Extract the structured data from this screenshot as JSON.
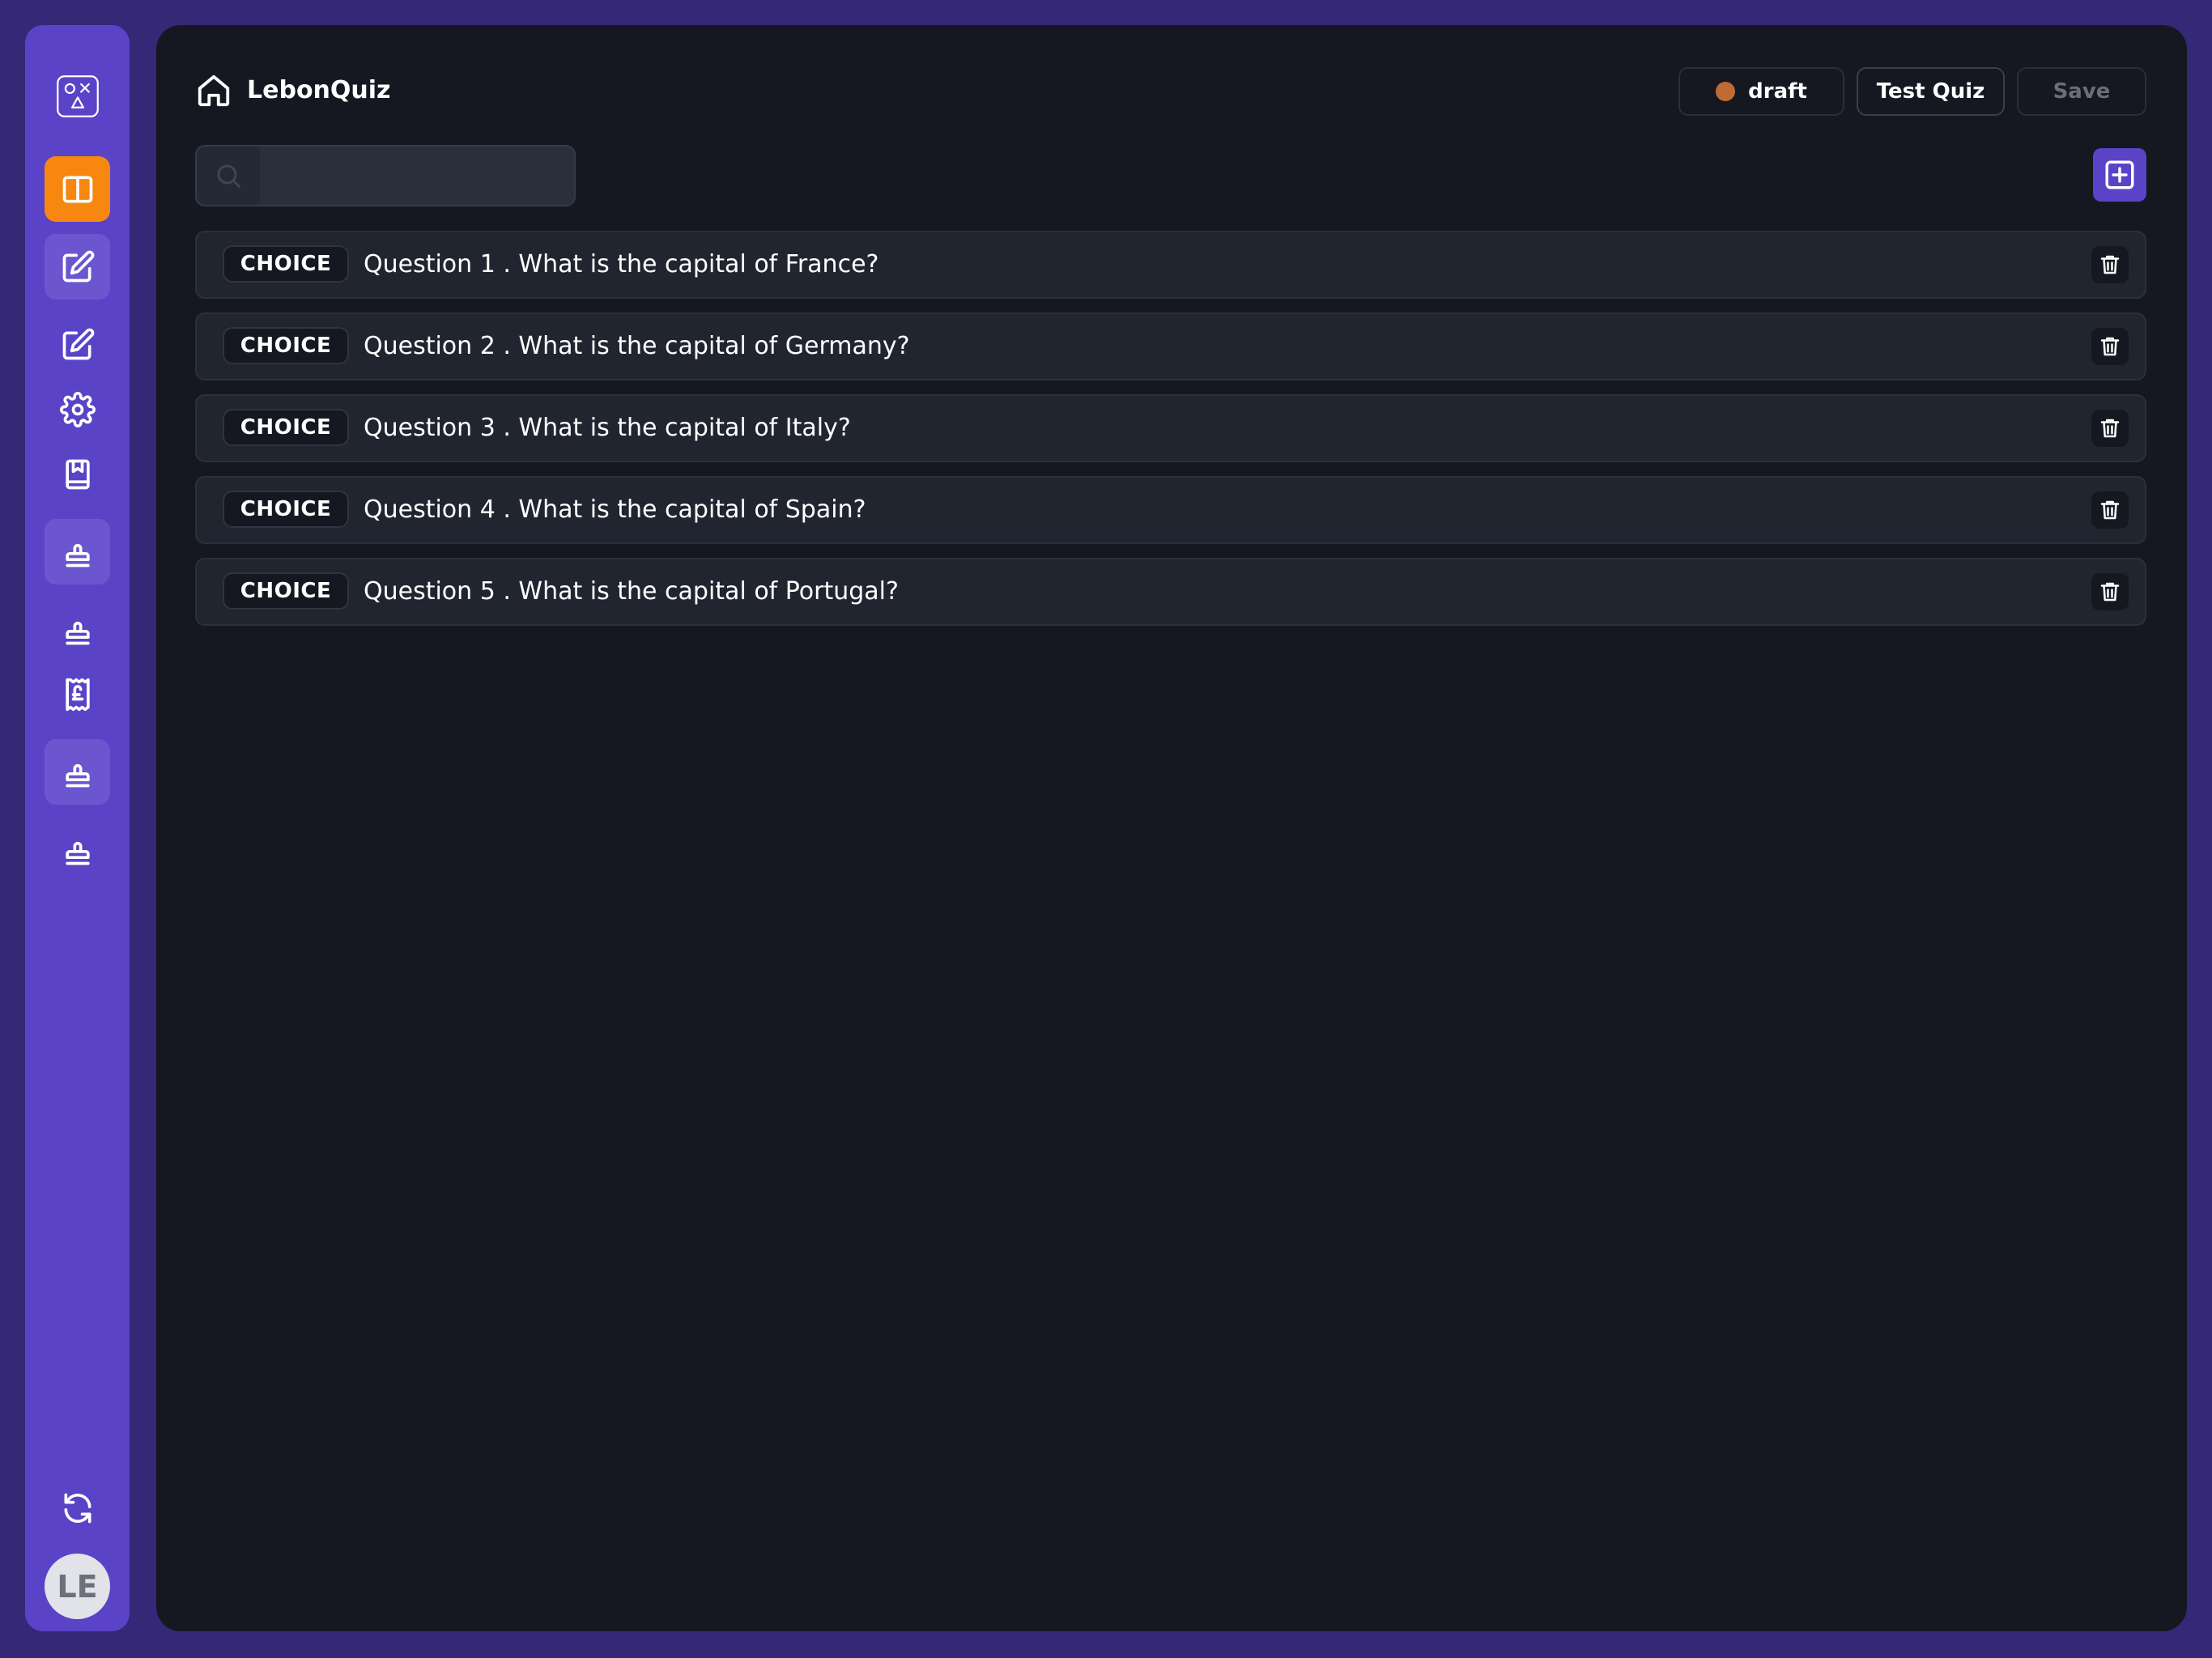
{
  "app": {
    "title": "LebonQuiz"
  },
  "header": {
    "status_label": "draft",
    "status_color": "#c06b32",
    "test_label": "Test Quiz",
    "save_label": "Save"
  },
  "search": {
    "value": "",
    "placeholder": ""
  },
  "sidebar": {
    "items": [
      {
        "icon": "logo-icon",
        "state": "default"
      },
      {
        "icon": "layout-panel-icon",
        "state": "active"
      },
      {
        "icon": "edit-icon",
        "state": "tinted"
      },
      {
        "icon": "edit-icon",
        "state": "default"
      },
      {
        "icon": "gear-icon",
        "state": "default"
      },
      {
        "icon": "bookmark-book-icon",
        "state": "default"
      },
      {
        "icon": "stamp-icon",
        "state": "tinted"
      },
      {
        "icon": "stamp-icon",
        "state": "default"
      },
      {
        "icon": "pound-receipt-icon",
        "state": "default"
      },
      {
        "icon": "stamp-icon",
        "state": "tinted"
      },
      {
        "icon": "stamp-icon",
        "state": "default"
      },
      {
        "icon": "refresh-icon",
        "state": "default"
      }
    ],
    "avatar_initials": "LE"
  },
  "questions": [
    {
      "type": "CHOICE",
      "text": "Question 1 . What is the capital of France?"
    },
    {
      "type": "CHOICE",
      "text": "Question 2 . What is the capital of Germany?"
    },
    {
      "type": "CHOICE",
      "text": "Question 3 . What is the capital of Italy?"
    },
    {
      "type": "CHOICE",
      "text": "Question 4 . What is the capital of Spain?"
    },
    {
      "type": "CHOICE",
      "text": "Question 5 . What is the capital of Portugal?"
    }
  ],
  "colors": {
    "accent": "#5a43c7",
    "active": "#f7870f",
    "background": "#151820"
  }
}
